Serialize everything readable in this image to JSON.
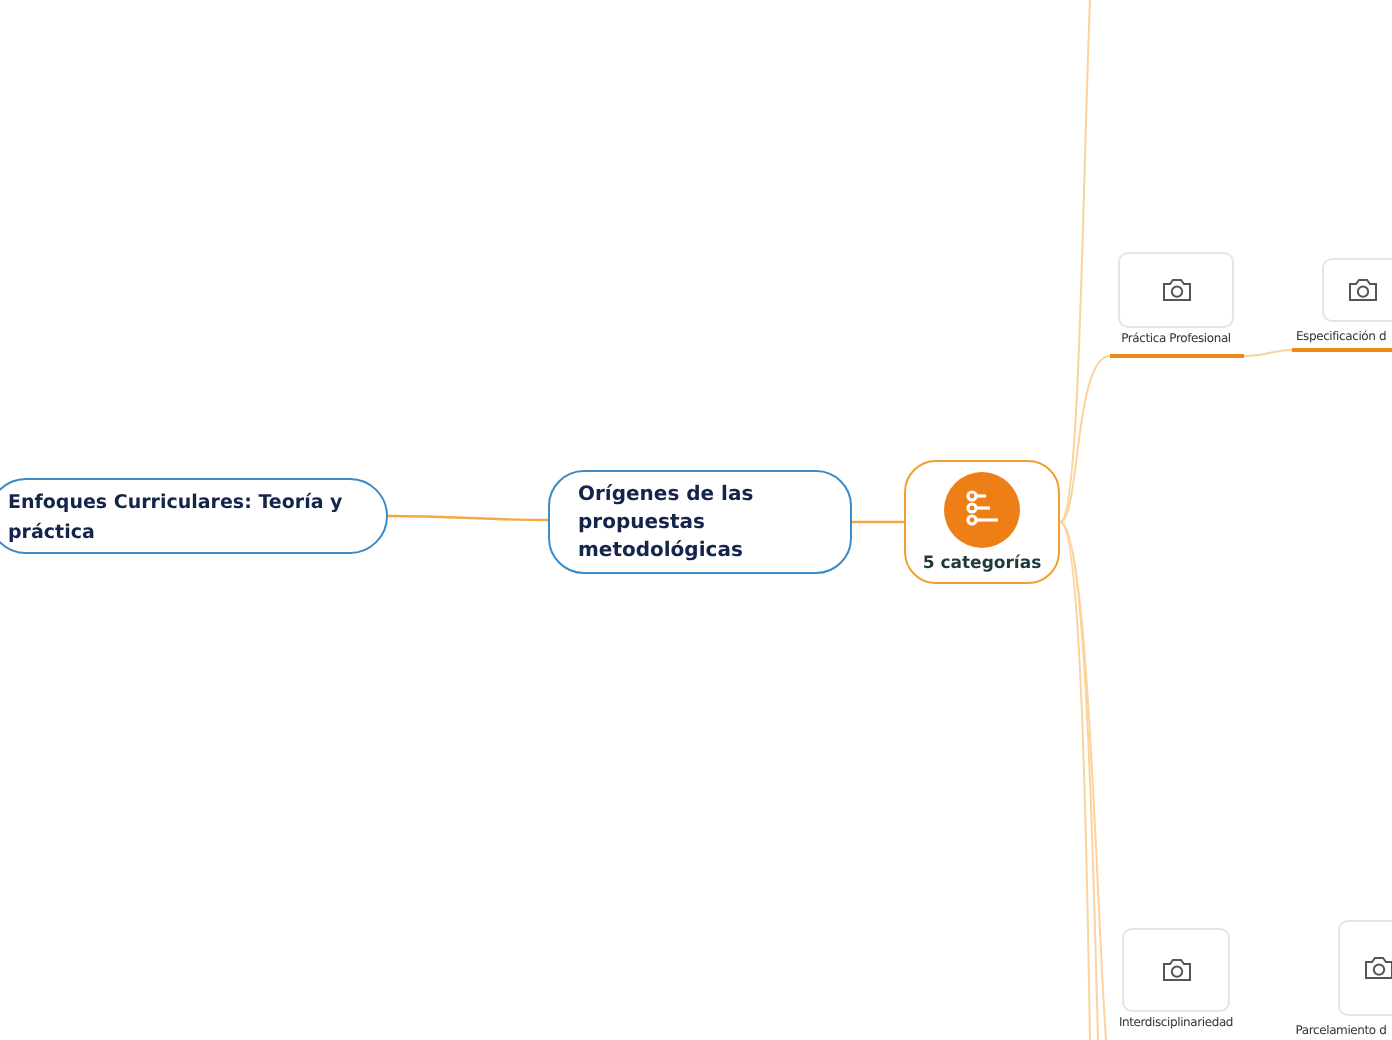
{
  "root": {
    "label": "Enfoques Curriculares: Teoría y práctica"
  },
  "main_topic": {
    "label": "Orígenes de las propuestas metodológicas"
  },
  "category_node": {
    "label": "5 categorías"
  },
  "subtopics": [
    {
      "label": "Práctica Profesional"
    },
    {
      "label": "Especificación d"
    },
    {
      "label": "Interdisciplinariedad"
    },
    {
      "label": "Parcelamiento d"
    }
  ]
}
